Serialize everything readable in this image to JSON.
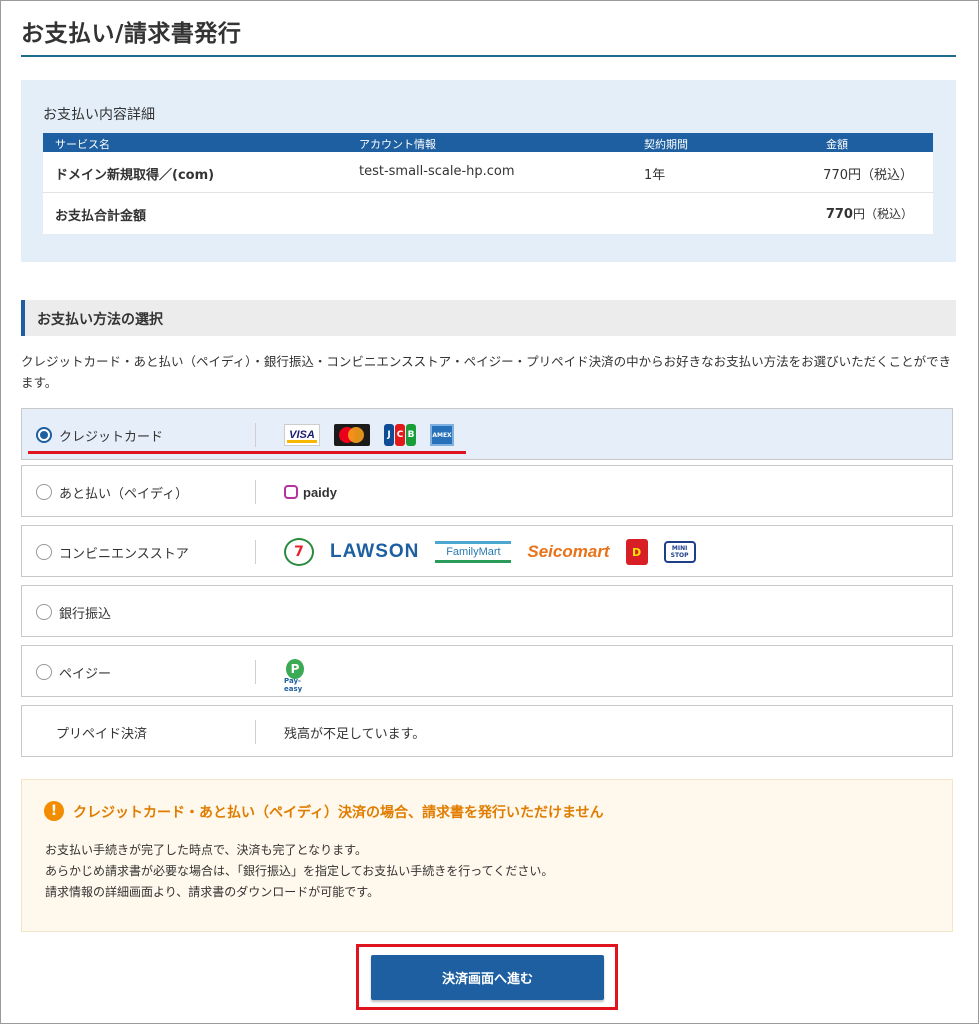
{
  "page": {
    "title": "お支払い/請求書発行"
  },
  "details": {
    "title": "お支払い内容詳細",
    "headers": [
      "サービス名",
      "アカウント情報",
      "契約期間",
      "金額"
    ],
    "row": {
      "service": "ドメイン新規取得／(com)",
      "account": "test-small-scale-hp.com",
      "period": "1年",
      "amount": "770円（税込）"
    },
    "total": {
      "label": "お支払合計金額",
      "amount_num": "770",
      "amount_unit": "円（税込）"
    }
  },
  "payment": {
    "heading": "お支払い方法の選択",
    "intro": "クレジットカード・あと払い（ペイディ）・銀行振込・コンビニエンスストア・ペイジー・プリペイド決済の中からお好きなお支払い方法をお選びいただくことができます。",
    "methods": [
      {
        "label": "クレジットカード",
        "selected": true,
        "logos": [
          "visa-logo",
          "mastercard-logo",
          "jcb-logo",
          "amex-logo"
        ]
      },
      {
        "label": "あと払い（ペイディ）",
        "selected": false,
        "logos": [
          "paidy-logo"
        ]
      },
      {
        "label": "コンビニエンスストア",
        "selected": false,
        "logos": [
          "seven-eleven-logo",
          "lawson-logo",
          "familymart-logo",
          "seicomart-logo",
          "daily-yamazaki-logo",
          "ministop-logo"
        ]
      },
      {
        "label": "銀行振込",
        "selected": false,
        "logos": []
      },
      {
        "label": "ペイジー",
        "selected": false,
        "logos": [
          "payeasy-logo"
        ]
      },
      {
        "label": "プリペイド決済",
        "selected": false,
        "message": "残高が不足しています。"
      }
    ],
    "logo_text": {
      "visa": "VISA",
      "jcb": [
        "J",
        "C",
        "B"
      ],
      "amex": "AMEX",
      "paidy": "paidy",
      "seven": "7",
      "lawson": "LAWSON",
      "familymart": "FamilyMart",
      "seicomart": "Seicomart",
      "daily": "D",
      "ministop": "MINI STOP",
      "payeasy_p": "P",
      "payeasy_t": "Pay-easy"
    }
  },
  "notice": {
    "title": "クレジットカード・あと払い（ペイディ）決済の場合、請求書を発行いただけません",
    "lines": [
      "お支払い手続きが完了した時点で、決済も完了となります。",
      "あらかじめ請求書が必要な場合は、「銀行振込」を指定してお支払い手続きを行ってください。",
      "請求情報の詳細画面より、請求書のダウンロードが可能です。"
    ]
  },
  "cta": {
    "label": "決済画面へ進む"
  },
  "colors": {
    "primary": "#1d5fa0",
    "highlight": "#e0141e",
    "warning": "#f28c00"
  }
}
